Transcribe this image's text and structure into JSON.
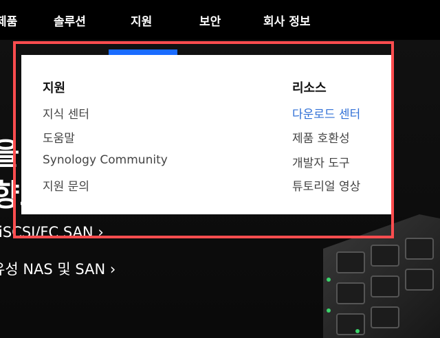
{
  "nav": {
    "items": [
      "제품",
      "솔루션",
      "지원",
      "보안",
      "회사 정보"
    ]
  },
  "hero": {
    "big_line1": "을 보",
    "big_line2": "향스",
    "link1": "iSCSI/FC SAN ›",
    "link2": "유성 NAS 및 SAN ›"
  },
  "dropdown": {
    "support": {
      "heading": "지원",
      "links": [
        "지식 센터",
        "도움말",
        "Synology Community",
        "지원 문의"
      ]
    },
    "resources": {
      "heading": "리소스",
      "links": [
        "다운로드 센터",
        "제품 호환성",
        "개발자 도구",
        "튜토리얼 영상"
      ]
    }
  },
  "colors": {
    "accent": "#1a6cff",
    "active_link": "#2f6fd6",
    "highlight": "#ff4d4f"
  }
}
